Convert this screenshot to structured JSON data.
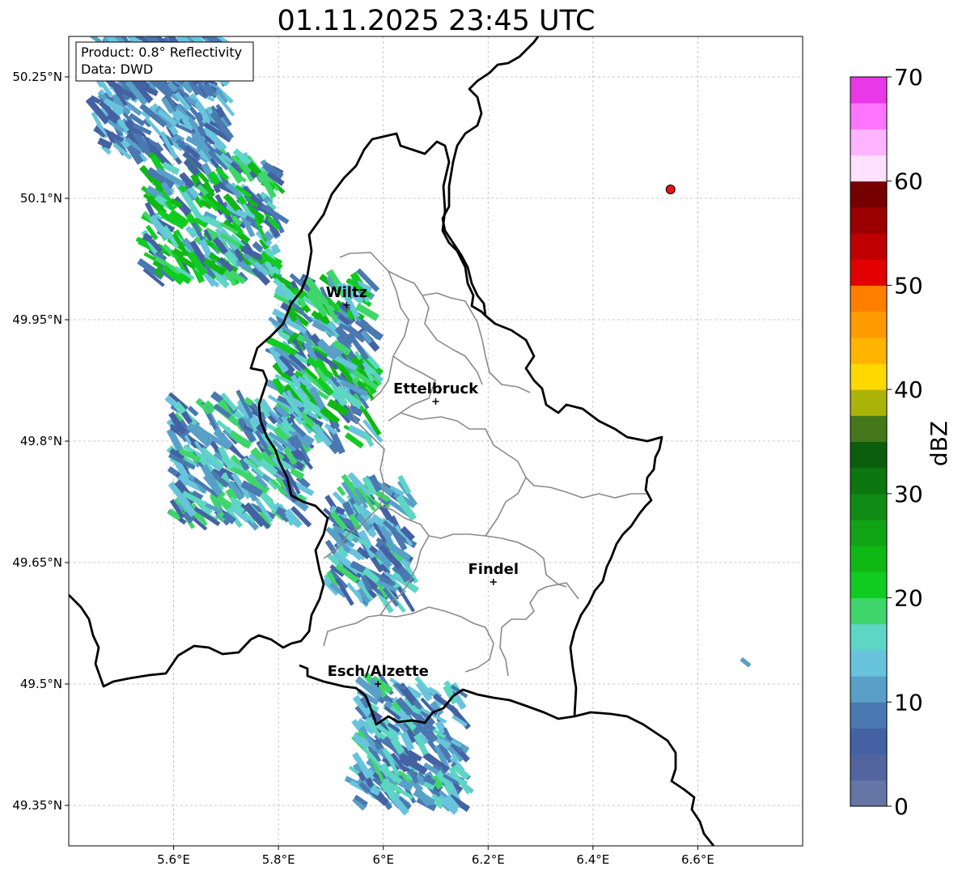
{
  "title": "01.11.2025 23:45 UTC",
  "info_box": {
    "product": "Product: 0.8° Reflectivity",
    "data": "Data: DWD"
  },
  "map": {
    "lon_range": [
      5.4,
      6.8
    ],
    "lat_range": [
      49.3,
      50.3
    ],
    "x_ticks": [
      {
        "value": 5.6,
        "label": "5.6°E"
      },
      {
        "value": 5.8,
        "label": "5.8°E"
      },
      {
        "value": 6.0,
        "label": "6°E"
      },
      {
        "value": 6.2,
        "label": "6.2°E"
      },
      {
        "value": 6.4,
        "label": "6.4°E"
      },
      {
        "value": 6.6,
        "label": "6.6°E"
      }
    ],
    "y_ticks": [
      {
        "value": 50.25,
        "label": "50.25°N"
      },
      {
        "value": 50.1,
        "label": "50.1°N"
      },
      {
        "value": 49.95,
        "label": "49.95°N"
      },
      {
        "value": 49.8,
        "label": "49.8°N"
      },
      {
        "value": 49.65,
        "label": "49.65°N"
      },
      {
        "value": 49.5,
        "label": "49.5°N"
      },
      {
        "value": 49.35,
        "label": "49.35°N"
      }
    ],
    "grid": true,
    "cities": [
      {
        "name": "Wiltz",
        "lon": 5.93,
        "lat": 49.968
      },
      {
        "name": "Ettelbruck",
        "lon": 6.1,
        "lat": 49.849
      },
      {
        "name": "Findel",
        "lon": 6.21,
        "lat": 49.626
      },
      {
        "name": "Esch/Alzette",
        "lon": 5.99,
        "lat": 49.5
      }
    ],
    "radar_site": {
      "lon": 6.548,
      "lat": 50.111,
      "color": "#ee1111"
    }
  },
  "colorbar": {
    "label": "dBZ",
    "min": 0,
    "max": 70,
    "ticks": [
      0,
      10,
      20,
      30,
      40,
      50,
      60,
      70
    ],
    "colors": [
      "#6475a6",
      "#52659e",
      "#4462a3",
      "#4a78b0",
      "#59a0c8",
      "#68c4dc",
      "#5dd6c4",
      "#3ed66a",
      "#10cc20",
      "#10b814",
      "#10a414",
      "#108c14",
      "#0c7610",
      "#0a5e0c",
      "#44781a",
      "#aab408",
      "#ffd800",
      "#ffb400",
      "#ff9a00",
      "#ff7e00",
      "#e20000",
      "#c00000",
      "#9a0000",
      "#760000",
      "#ffe0ff",
      "#ffb4ff",
      "#ff74ff",
      "#e838e8"
    ]
  },
  "chart_data": {
    "type": "heatmap",
    "title": "01.11.2025 23:45 UTC",
    "xlabel": "",
    "ylabel": "",
    "xlim": [
      5.4,
      6.8
    ],
    "ylim": [
      49.3,
      50.3
    ],
    "colorbar_label": "dBZ",
    "clim": [
      0,
      70
    ],
    "echo_regions": [
      {
        "lon": [
          5.45,
          5.7
        ],
        "lat": [
          50.15,
          50.3
        ],
        "dbz": [
          5,
          15
        ]
      },
      {
        "lon": [
          5.55,
          5.8
        ],
        "lat": [
          50.0,
          50.15
        ],
        "dbz": [
          5,
          25
        ]
      },
      {
        "lon": [
          5.8,
          5.98
        ],
        "lat": [
          49.8,
          50.0
        ],
        "dbz": [
          5,
          25
        ]
      },
      {
        "lon": [
          5.6,
          5.85
        ],
        "lat": [
          49.7,
          49.85
        ],
        "dbz": [
          5,
          20
        ]
      },
      {
        "lon": [
          5.9,
          6.05
        ],
        "lat": [
          49.6,
          49.75
        ],
        "dbz": [
          5,
          20
        ]
      },
      {
        "lon": [
          5.95,
          6.15
        ],
        "lat": [
          49.35,
          49.5
        ],
        "dbz": [
          5,
          18
        ]
      },
      {
        "lon": [
          6.68,
          6.7
        ],
        "lat": [
          49.53,
          49.53
        ],
        "dbz": [
          5,
          12
        ]
      }
    ]
  }
}
